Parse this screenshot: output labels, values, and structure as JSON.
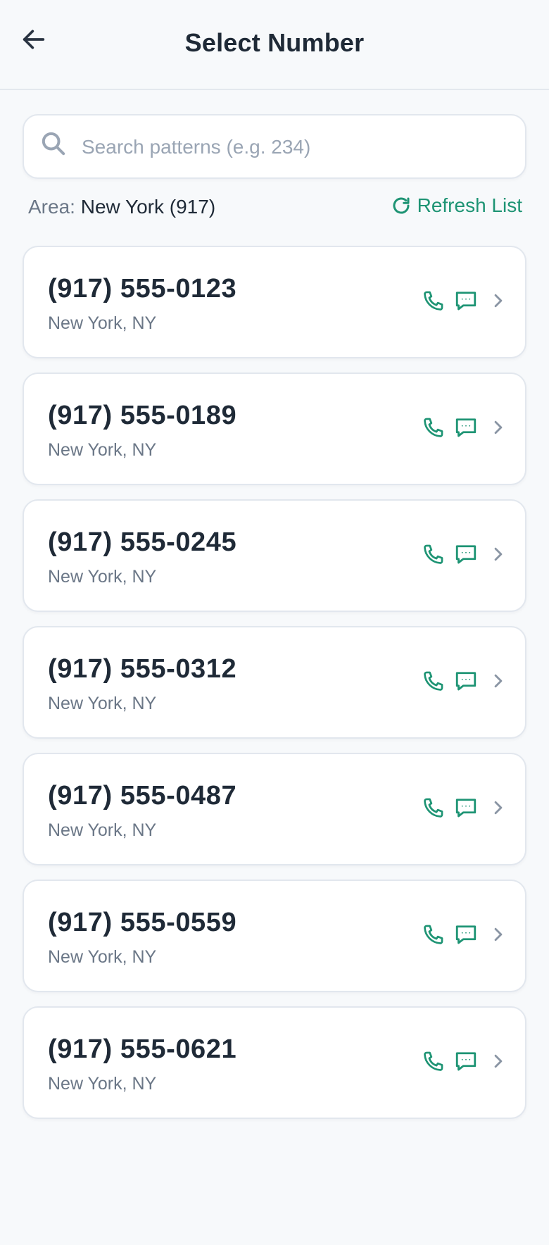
{
  "header": {
    "title": "Select Number"
  },
  "search": {
    "placeholder": "Search patterns (e.g. 234)",
    "value": ""
  },
  "area": {
    "label": "Area:",
    "value": "New York (917)"
  },
  "refresh": {
    "label": "Refresh List"
  },
  "numbers": [
    {
      "number": "(917) 555-0123",
      "location": "New York, NY"
    },
    {
      "number": "(917) 555-0189",
      "location": "New York, NY"
    },
    {
      "number": "(917) 555-0245",
      "location": "New York, NY"
    },
    {
      "number": "(917) 555-0312",
      "location": "New York, NY"
    },
    {
      "number": "(917) 555-0487",
      "location": "New York, NY"
    },
    {
      "number": "(917) 555-0559",
      "location": "New York, NY"
    },
    {
      "number": "(917) 555-0621",
      "location": "New York, NY"
    }
  ],
  "colors": {
    "accent": "#1e9474",
    "text_primary": "#1f2a37",
    "text_secondary": "#6b7787",
    "background": "#f7f9fb",
    "card_border": "#e2e7ee"
  },
  "icons": {
    "back": "arrow-left-icon",
    "search": "search-icon",
    "refresh": "refresh-icon",
    "call": "phone-icon",
    "sms": "message-icon",
    "chevron": "chevron-right-icon"
  }
}
